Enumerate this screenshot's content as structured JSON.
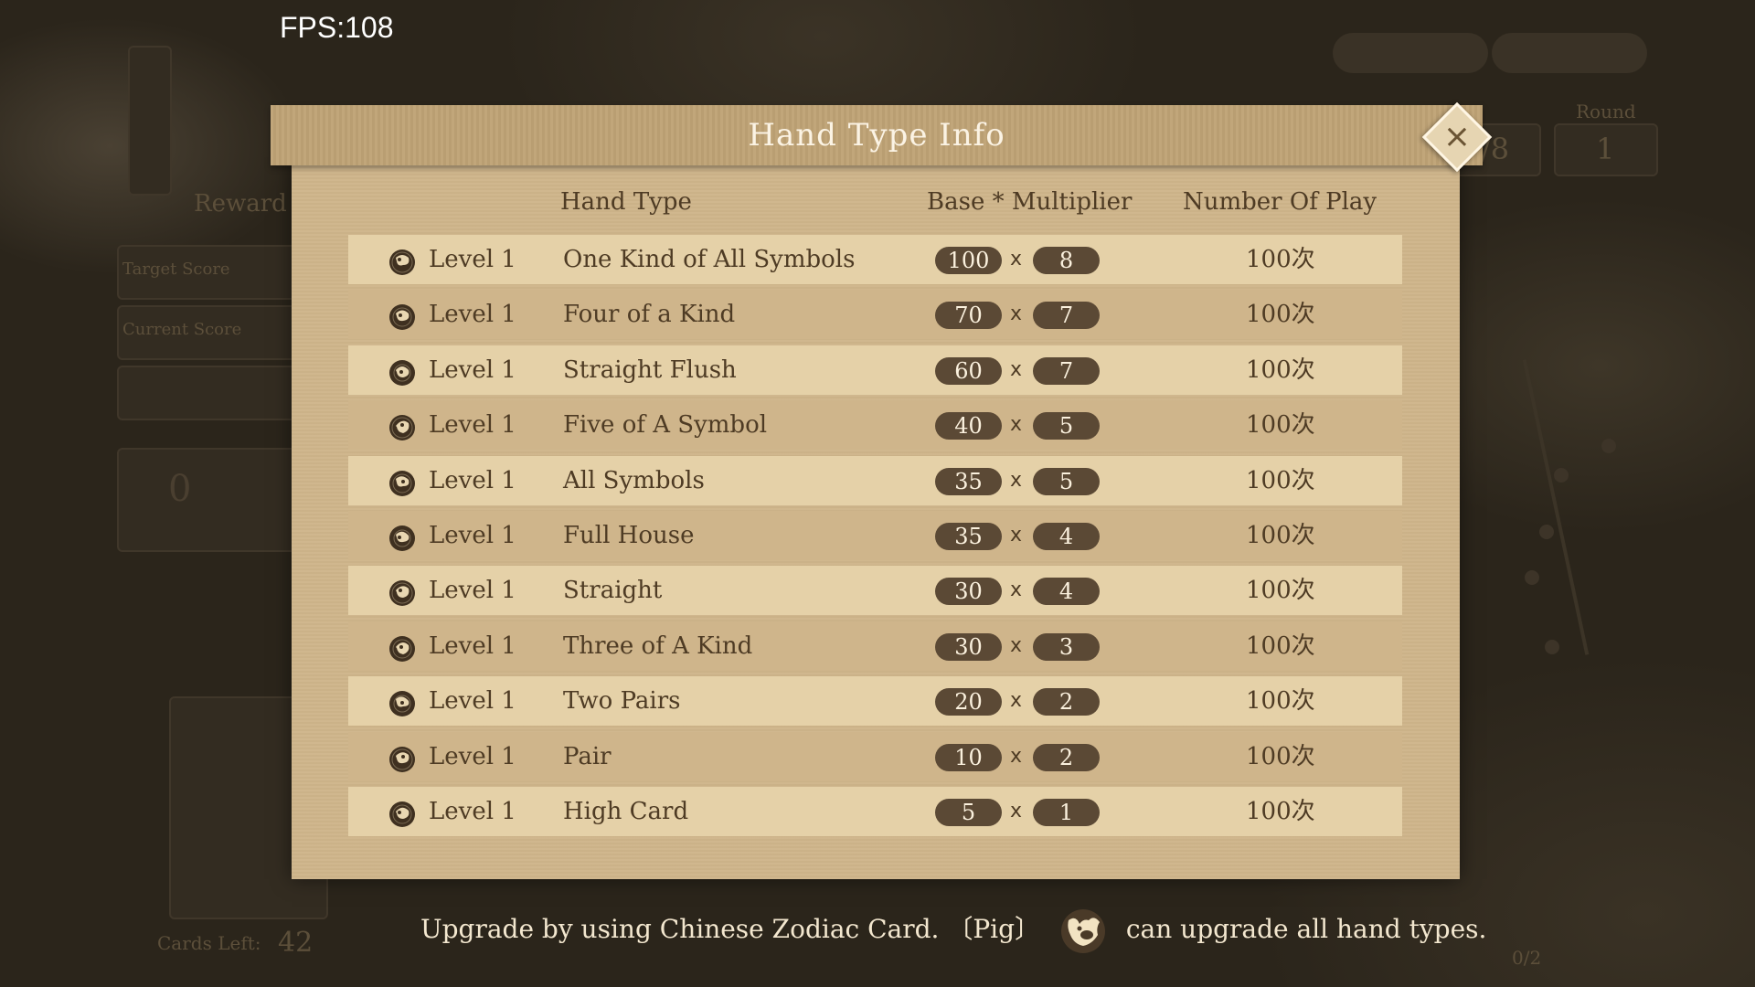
{
  "hud": {
    "fps": "FPS:108"
  },
  "background": {
    "reward_label": "Reward",
    "target_score_label": "Target Score",
    "current_score_label": "Current Score",
    "score_value": "0",
    "cards_left_label": "Cards Left:",
    "cards_left_value": "42",
    "round_label": "Round",
    "round_value": "1",
    "ante_value": "/8",
    "progress": "0/2"
  },
  "modal": {
    "title": "Hand Type Info",
    "close_label": "×",
    "columns": {
      "hand_type": "Hand Type",
      "base_multiplier": "Base * Multiplier",
      "number_of_play": "Number Of Play"
    },
    "times_symbol": "x",
    "rows": [
      {
        "icon": "rat-zodiac-icon",
        "level": "Level 1",
        "name": "One Kind of All Symbols",
        "base": "100",
        "multiplier": "8",
        "plays": "100次"
      },
      {
        "icon": "ox-zodiac-icon",
        "level": "Level 1",
        "name": "Four of a Kind",
        "base": "70",
        "multiplier": "7",
        "plays": "100次"
      },
      {
        "icon": "tiger-zodiac-icon",
        "level": "Level 1",
        "name": "Straight Flush",
        "base": "60",
        "multiplier": "7",
        "plays": "100次"
      },
      {
        "icon": "rabbit-zodiac-icon",
        "level": "Level 1",
        "name": "Five of A Symbol",
        "base": "40",
        "multiplier": "5",
        "plays": "100次"
      },
      {
        "icon": "dragon-zodiac-icon",
        "level": "Level 1",
        "name": "All Symbols",
        "base": "35",
        "multiplier": "5",
        "plays": "100次"
      },
      {
        "icon": "snake-zodiac-icon",
        "level": "Level 1",
        "name": "Full House",
        "base": "35",
        "multiplier": "4",
        "plays": "100次"
      },
      {
        "icon": "horse-zodiac-icon",
        "level": "Level 1",
        "name": "Straight",
        "base": "30",
        "multiplier": "4",
        "plays": "100次"
      },
      {
        "icon": "goat-zodiac-icon",
        "level": "Level 1",
        "name": "Three of A Kind",
        "base": "30",
        "multiplier": "3",
        "plays": "100次"
      },
      {
        "icon": "monkey-zodiac-icon",
        "level": "Level 1",
        "name": "Two Pairs",
        "base": "20",
        "multiplier": "2",
        "plays": "100次"
      },
      {
        "icon": "rooster-zodiac-icon",
        "level": "Level 1",
        "name": "Pair",
        "base": "10",
        "multiplier": "2",
        "plays": "100次"
      },
      {
        "icon": "dog-zodiac-icon",
        "level": "Level 1",
        "name": "High Card",
        "base": "5",
        "multiplier": "1",
        "plays": "100次"
      }
    ]
  },
  "footer": {
    "text_before": "Upgrade by using Chinese Zodiac Card. 〔Pig〕",
    "pig_icon": "pig-zodiac-icon",
    "text_after": "can upgrade all hand types."
  },
  "colors": {
    "panel": "#cfb58b",
    "row_highlight": "#e5d1a8",
    "header": "#bfa376",
    "pill": "#5b4935",
    "text_dark": "#4e3b24"
  }
}
